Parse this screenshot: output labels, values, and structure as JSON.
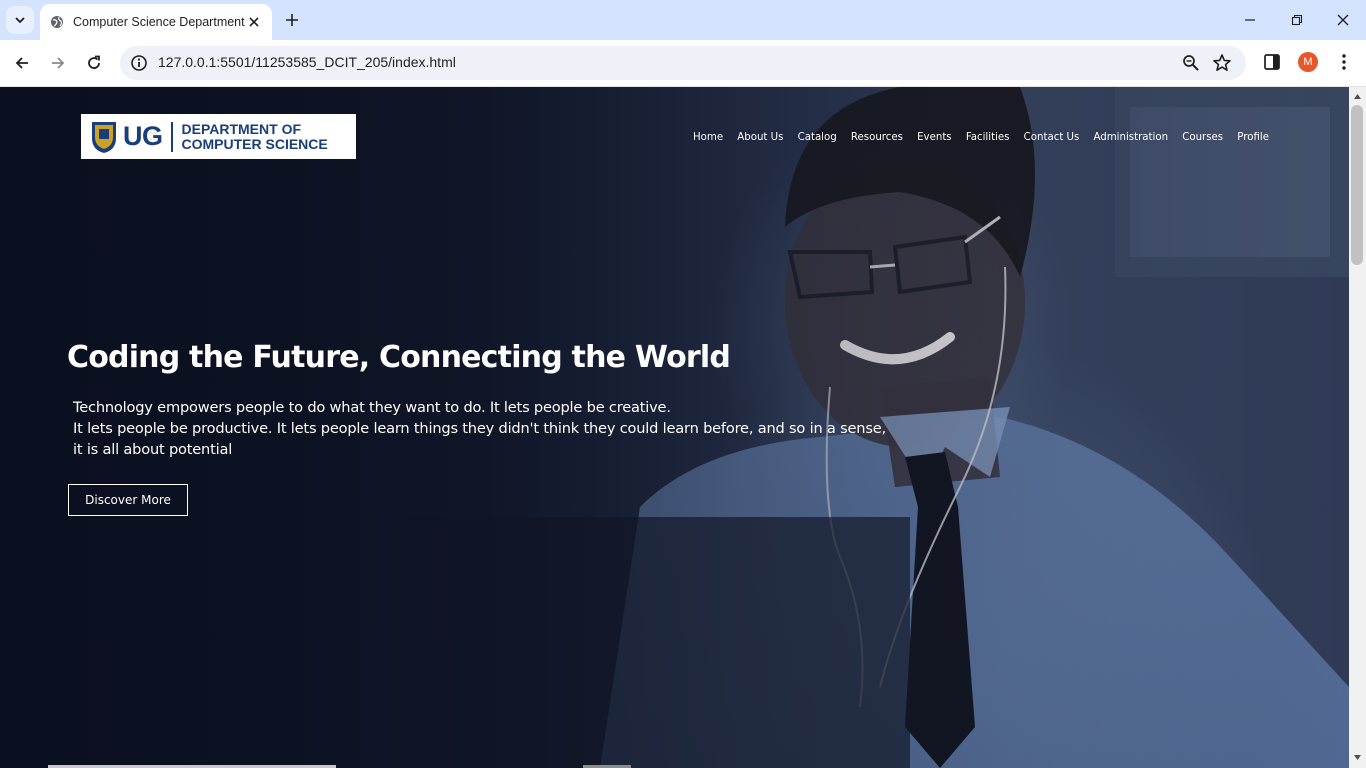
{
  "browser": {
    "tab_title": "Computer Science Department",
    "url": "127.0.0.1:5501/11253585_DCIT_205/index.html",
    "profile_initial": "M"
  },
  "site": {
    "logo": {
      "mark": "UG",
      "dept_line1": "DEPARTMENT OF",
      "dept_line2": "COMPUTER SCIENCE"
    },
    "nav": [
      "Home",
      "About Us",
      "Catalog",
      "Resources",
      "Events",
      "Facilities",
      "Contact Us",
      "Administration",
      "Courses",
      "Profile"
    ],
    "hero": {
      "headline": "Coding the Future, Connecting the World",
      "lead_lines": [
        "Technology empowers people to do what they want to do. It lets people be creative.",
        "It lets people be productive. It lets people learn things they didn't think they could learn before, and so in a sense,",
        "it is all about potential"
      ],
      "cta_label": "Discover More"
    }
  },
  "colors": {
    "tabbar": "#d3e3fd",
    "brand_blue": "#1a3d7c",
    "avatar": "#e8562a"
  }
}
